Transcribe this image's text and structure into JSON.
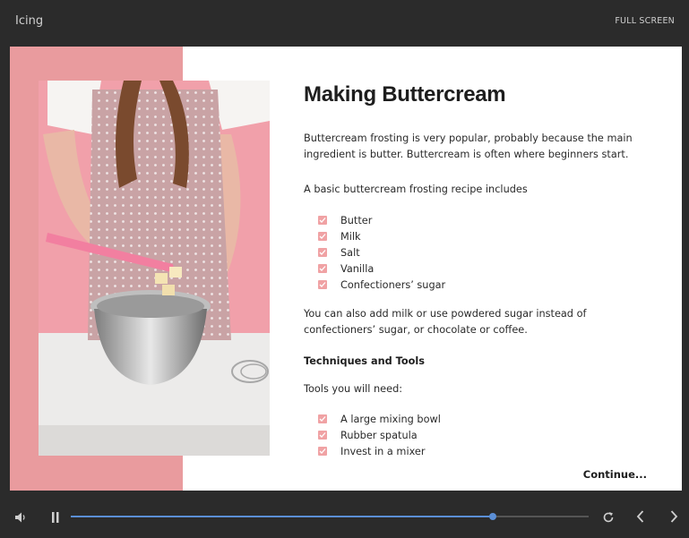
{
  "header": {
    "title": "Icing",
    "fullscreen_label": "FULL SCREEN"
  },
  "slide": {
    "heading": "Making Buttercream",
    "intro": "Buttercream frosting is very popular, probably because the main ingredient is butter. Buttercream is often where beginners start.",
    "recipe_intro": "A basic buttercream frosting recipe includes",
    "ingredients": [
      {
        "label": "Butter"
      },
      {
        "label": "Milk"
      },
      {
        "label": "Salt"
      },
      {
        "label": "Vanilla"
      },
      {
        "label": "Confectioners’ sugar"
      }
    ],
    "alternatives": "You can also add milk or use powdered sugar instead of confectioners’ sugar, or chocolate or coffee.",
    "techniques_heading": "Techniques and Tools",
    "tools_intro": "Tools you will need:",
    "tools": [
      {
        "label": "A large mixing bowl"
      },
      {
        "label": "Rubber spatula"
      },
      {
        "label": "Invest in a mixer"
      }
    ],
    "continue_label": "Continue..."
  },
  "player": {
    "progress": 0.815,
    "icons": [
      "volume-icon",
      "pause-icon",
      "replay-icon",
      "prev-icon",
      "next-icon"
    ]
  },
  "colors": {
    "accent": "#f0a2a4",
    "band": "#e99b9e",
    "progress": "#5b8fd6"
  }
}
